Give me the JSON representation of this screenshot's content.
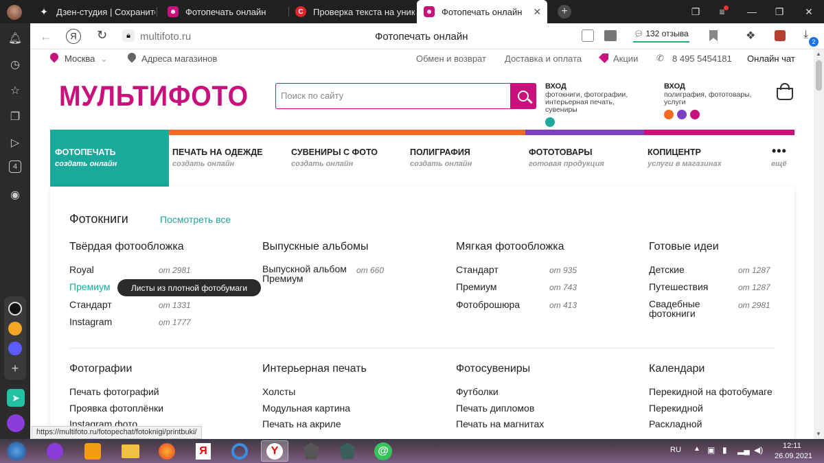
{
  "tabs": [
    {
      "title": "Дзен-студия | Сохраните и"
    },
    {
      "title": "Фотопечать онлайн"
    },
    {
      "title": "Проверка текста на уника"
    },
    {
      "title": "Фотопечать онлайн"
    }
  ],
  "address": {
    "domain": "multifoto.ru",
    "page_title": "Фотопечать онлайн",
    "reviews": "132 отзыва",
    "download_count": "2"
  },
  "topbar": {
    "city": "Москва",
    "stores": "Адреса магазинов",
    "returns": "Обмен и возврат",
    "delivery": "Доставка и оплата",
    "promo": "Акции",
    "phone": "8 495 5454181",
    "chat": "Онлайн чат"
  },
  "logo": "МУЛЬТИФОТО",
  "search": {
    "placeholder": "Поиск по сайту"
  },
  "login1": {
    "title": "ВХОД",
    "desc": "фотокниги, фотографии, интерьерная печать, сувениры"
  },
  "login2": {
    "title": "ВХОД",
    "desc": "полиграфия, фототовары, услуги"
  },
  "menu": [
    {
      "title": "ФОТОПЕЧАТЬ",
      "sub": "создать онлайн"
    },
    {
      "title": "ПЕЧАТЬ НА ОДЕЖДЕ",
      "sub": "создать онлайн"
    },
    {
      "title": "СУВЕНИРЫ С ФОТО",
      "sub": "создать онлайн"
    },
    {
      "title": "ПОЛИГРАФИЯ",
      "sub": "создать онлайн"
    },
    {
      "title": "ФОТОТОВАРЫ",
      "sub": "готовая продукция"
    },
    {
      "title": "КОПИЦЕНТР",
      "sub": "услуги в магазинах"
    },
    {
      "title": "",
      "sub": "ещё"
    }
  ],
  "section": {
    "title": "Фотокниги",
    "see_all": "Посмотреть все"
  },
  "columns": [
    {
      "title": "Твёрдая фотообложка",
      "items": [
        {
          "name": "Royal",
          "price": "от 2981"
        },
        {
          "name": "Премиум",
          "price": ""
        },
        {
          "name": "Стандарт",
          "price": "от 1331"
        },
        {
          "name": "Instagram",
          "price": "от 1777"
        }
      ]
    },
    {
      "title": "Выпускные альбомы",
      "items": [
        {
          "name": "Выпускной альбом Премиум",
          "price": "от 660"
        }
      ]
    },
    {
      "title": "Мягкая фотообложка",
      "items": [
        {
          "name": "Стандарт",
          "price": "от 935"
        },
        {
          "name": "Премиум",
          "price": "от 743"
        },
        {
          "name": "Фотоброшюра",
          "price": "от 413"
        }
      ]
    },
    {
      "title": "Готовые идеи",
      "items": [
        {
          "name": "Детские",
          "price": "от 1287"
        },
        {
          "name": "Путешествия",
          "price": "от 1287"
        },
        {
          "name": "Свадебные фотокниги",
          "price": "от 2981"
        }
      ]
    }
  ],
  "tooltip": "Листы из плотной фотобумаги",
  "columns2": [
    {
      "title": "Фотографии",
      "items": [
        "Печать фотографий",
        "Проявка фотоплёнки",
        "Instagram фото"
      ]
    },
    {
      "title": "Интерьерная печать",
      "items": [
        "Холсты",
        "Модульная картина",
        "Печать на акриле"
      ]
    },
    {
      "title": "Фотосувениры",
      "items": [
        "Футболки",
        "Печать дипломов",
        "Печать на магнитах"
      ]
    },
    {
      "title": "Календари",
      "items": [
        "Перекидной на фотобумаге",
        "Перекидной",
        "Раскладной"
      ]
    }
  ],
  "status_url": "https://multifoto.ru/fotopechat/fotoknigi/printbuki/",
  "tray": {
    "lang": "RU",
    "time": "12:11",
    "date": "26.09.2021"
  },
  "colors": {
    "brand": "#c8117d",
    "teal": "#1aa99a",
    "orange": "#ef6c22",
    "purple": "#7b3fc4"
  }
}
